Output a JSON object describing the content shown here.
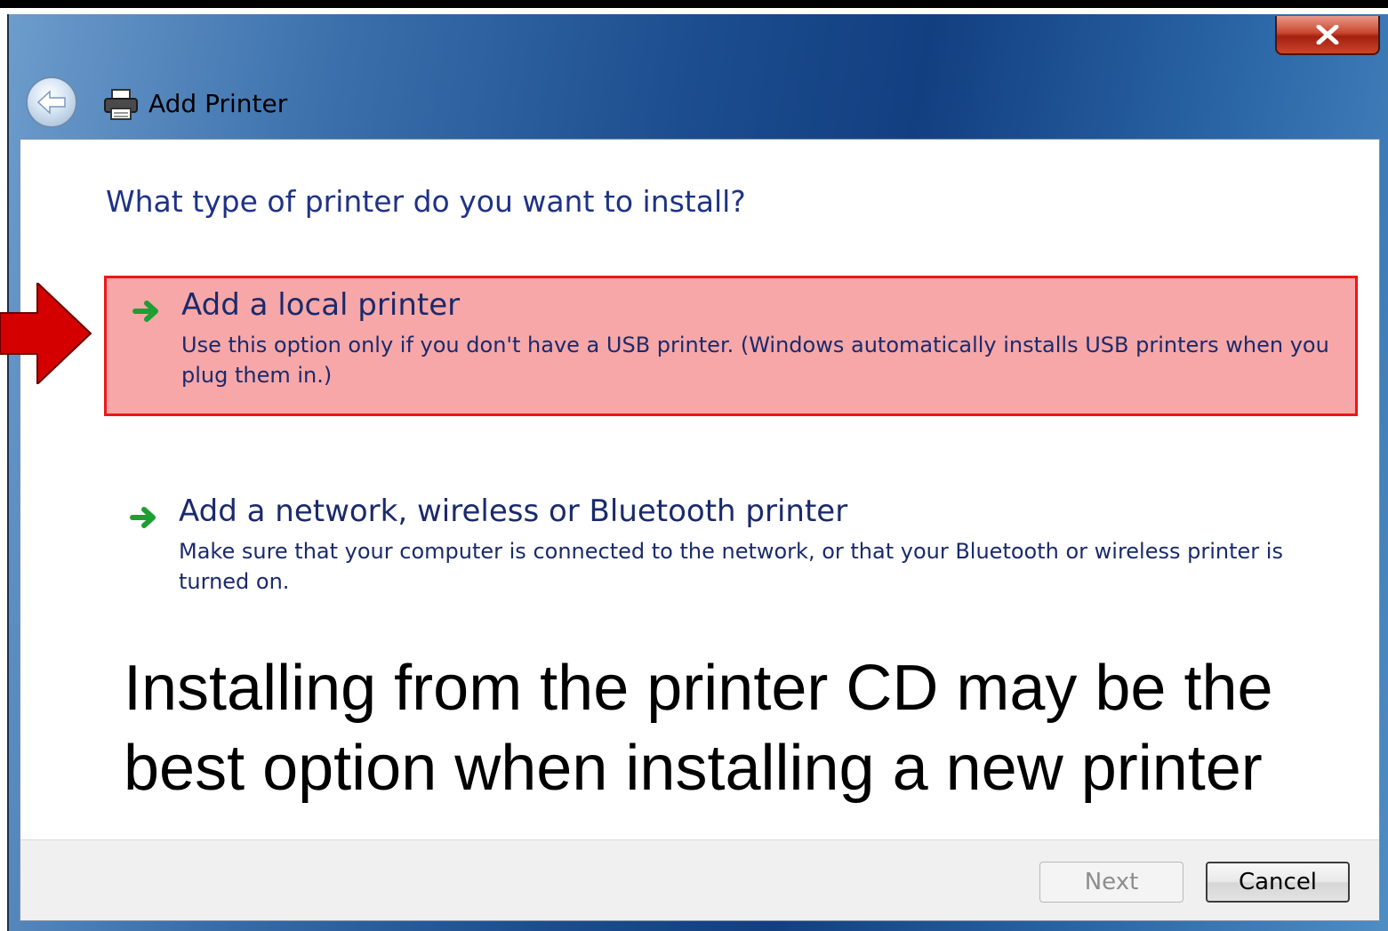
{
  "window": {
    "title": "Add Printer",
    "close_label": "x"
  },
  "wizard": {
    "heading": "What type of printer do you want to install?",
    "options": [
      {
        "title": "Add a local printer",
        "description": "Use this option only if you don't have a USB printer. (Windows automatically installs USB printers when you plug them in.)",
        "highlighted": true
      },
      {
        "title": "Add a network, wireless or Bluetooth printer",
        "description": "Make sure that your computer is connected to the network, or that your Bluetooth or wireless printer is turned on.",
        "highlighted": false
      }
    ]
  },
  "annotation": {
    "note": "Installing from the printer CD may be the best option when installing a new printer"
  },
  "footer": {
    "next_label": "Next",
    "cancel_label": "Cancel"
  },
  "colors": {
    "highlight_fill": "#f7a7a7",
    "highlight_border": "#ef1515",
    "heading_text": "#1e3287",
    "pointer_arrow": "#d40000"
  },
  "icons": {
    "back": "back-arrow-icon",
    "printer": "printer-icon",
    "option_arrow": "green-right-arrow-icon",
    "pointer": "red-pointer-arrow-icon"
  }
}
